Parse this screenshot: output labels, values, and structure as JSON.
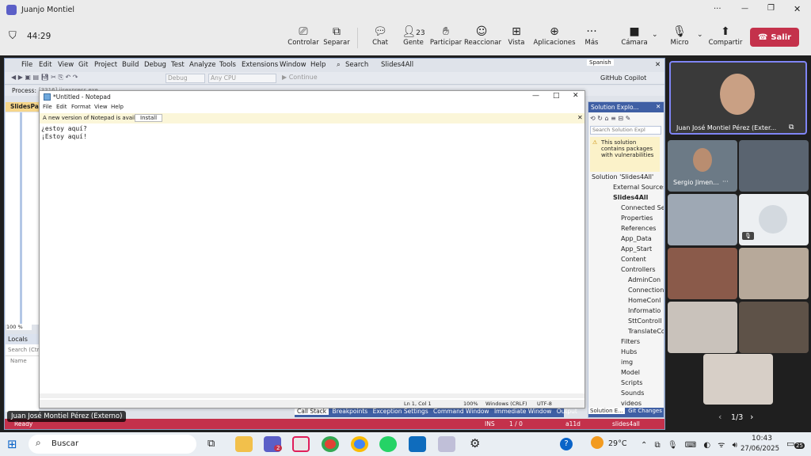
{
  "window": {
    "title": "Juanjo Montiel",
    "minimize": "—",
    "restore": "❐",
    "close": "✕",
    "more": "···"
  },
  "meeting": {
    "timer": "44:29",
    "shield": "⛉"
  },
  "toolbar": {
    "controlar": "Controlar",
    "separar": "Separar",
    "chat": "Chat",
    "gente": "Gente",
    "gente_count": "23",
    "participar": "Participar",
    "reaccionar": "Reaccionar",
    "vista": "Vista",
    "aplicaciones": "Aplicaciones",
    "mas": "Más",
    "camara": "Cámara",
    "micro": "Micro",
    "compartir": "Compartir",
    "salir": "Salir"
  },
  "vs": {
    "menu": [
      "File",
      "Edit",
      "View",
      "Git",
      "Project",
      "Build",
      "Debug",
      "Test",
      "Analyze",
      "Tools",
      "Extensions",
      "Window",
      "Help"
    ],
    "search": "Search",
    "solution_name": "Slides4All",
    "language": "Spanish",
    "debug": "Debug",
    "cpu": "Any CPU",
    "continue": "Continue",
    "copilot": "GitHub Copilot",
    "process": "Process:",
    "process_val": "[3316] iisexpress.exe",
    "tab": "SlidesPart",
    "zoom": "100 %",
    "locals": "Locals",
    "search_locals": "Search (Ctrl+E)",
    "name_col": "Name",
    "bottom_tabs": [
      "Call Stack",
      "Breakpoints",
      "Exception Settings",
      "Command Window",
      "Immediate Window",
      "Output"
    ],
    "status_ready": "Ready",
    "status_ins": "INS",
    "status_nav": "1 / 0",
    "status_a11d": "a11d",
    "status_branch": "slides4all"
  },
  "notepad": {
    "title": "*Untitled - Notepad",
    "menu": [
      "File",
      "Edit",
      "Format",
      "View",
      "Help"
    ],
    "banner": "A new version of Notepad is available.",
    "install": "Install",
    "lines": [
      "¿estoy aquí?",
      "¡Estoy aquí!"
    ],
    "status_pos": "Ln 1, Col 1",
    "status_zoom": "100%",
    "status_eol": "Windows (CRLF)",
    "status_enc": "UTF-8"
  },
  "solution_explorer": {
    "title": "Solution Explo...",
    "search": "Search Solution Expl",
    "warning": "This solution contains packages with vulnerabilities",
    "items": [
      "Solution 'Slides4All'",
      "External Sources",
      "Slides4All",
      "Connected Se",
      "Properties",
      "References",
      "App_Data",
      "App_Start",
      "Content",
      "Controllers",
      "AdminCon",
      "Connection",
      "HomeConl",
      "Informatio",
      "SttControll",
      "TranslateCo",
      "Filters",
      "Hubs",
      "img",
      "Model",
      "Scripts",
      "Sounds",
      "videos"
    ],
    "tab1": "Solution E...",
    "tab2": "Git Changes"
  },
  "participants": {
    "presenter": "Juan José Montiel Pérez (Exter...",
    "p1": "Sergio Jimen...",
    "pages": "1/3",
    "caption": "Juan José Montiel Pérez (Externo)"
  },
  "taskbar": {
    "search": "Buscar",
    "temp": "29°C",
    "time": "10:43",
    "date": "27/06/2025",
    "notif": "25",
    "badge": "2"
  }
}
